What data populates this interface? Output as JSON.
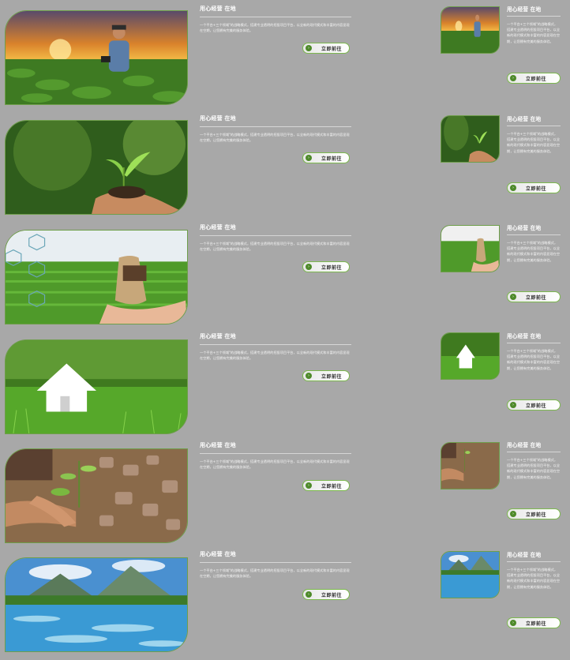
{
  "cards": [
    {
      "title": "用心经营 在地",
      "desc": "一个平台+三个领域\"的战略模式，搭建专业透明的招投项目平台，以全新的现代模式和丰富的内容显现在空期，让您拥有完美的服务体验。",
      "button": "立即前往",
      "image": "farmer-with-tablet-at-sunset"
    },
    {
      "title": "用心经营 在地",
      "desc": "一个平台+三个领域\"的战略模式，搭建专业透明的招投项目平台，以全新的现代模式和丰富的内容显现在空期，让您拥有完美的服务体验。",
      "button": "立即前往",
      "image": "hands-holding-seedling"
    },
    {
      "title": "用心经营 在地",
      "desc": "一个平台+三个领域\"的战略模式，搭建专业透明的招投项目平台，以全新的现代模式和丰富的内容显现在空期，让您拥有完美的服务体验。",
      "button": "立即前往",
      "image": "money-bag-over-field"
    },
    {
      "title": "用心经营 在地",
      "desc": "一个平台+三个领域\"的战略模式，搭建专业透明的招投项目平台，以全新的现代模式和丰富的内容显现在空期，让您拥有完美的服务体验。",
      "button": "立即前往",
      "image": "house-on-grass"
    },
    {
      "title": "用心经营 在地",
      "desc": "一个平台+三个领域\"的战略模式，搭建专业透明的招投项目平台，以全新的现代模式和丰富的内容显现在空期，让您拥有完美的服务体验。",
      "button": "立即前往",
      "image": "children-planting-tree"
    },
    {
      "title": "用心经营 在地",
      "desc": "一个平台+三个领域\"的战略模式，搭建专业透明的招投项目平台，以全新的现代模式和丰富的内容显现在空期，让您拥有完美的服务体验。",
      "button": "立即前往",
      "image": "mountain-river"
    }
  ],
  "colors": {
    "background": "#a8a8a8",
    "accent": "#7cb84e",
    "button_dot": "#4e8a2a"
  }
}
